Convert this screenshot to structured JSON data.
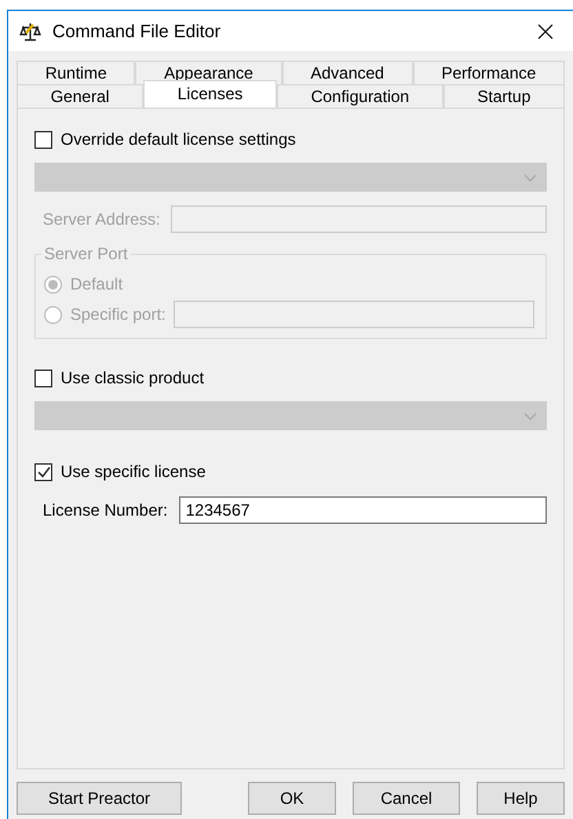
{
  "window": {
    "title": "Command File Editor"
  },
  "tab_rows": [
    [
      {
        "label": "Runtime",
        "selected": false
      },
      {
        "label": "Appearance",
        "selected": false
      },
      {
        "label": "Advanced",
        "selected": false
      },
      {
        "label": "Performance",
        "selected": false
      }
    ],
    [
      {
        "label": "General",
        "selected": false
      },
      {
        "label": "Licenses",
        "selected": true
      },
      {
        "label": "Configuration",
        "selected": false
      },
      {
        "label": "Startup",
        "selected": false
      }
    ]
  ],
  "override": {
    "label": "Override default license settings",
    "checked": false
  },
  "license_dropdown": {
    "disabled": true
  },
  "server_address": {
    "label": "Server Address:",
    "disabled": true
  },
  "server_port": {
    "title": "Server Port",
    "disabled": true,
    "options": [
      {
        "label": "Default",
        "selected": true,
        "has_field": false
      },
      {
        "label": "Specific port:",
        "selected": false,
        "has_field": true
      }
    ]
  },
  "classic_product": {
    "label": "Use classic product",
    "checked": false
  },
  "classic_dropdown": {
    "disabled": true
  },
  "specific_license": {
    "label": "Use specific license",
    "checked": true
  },
  "license_number": {
    "label": "License Number:",
    "value": "1234567",
    "disabled": false
  },
  "footer": {
    "left_buttons": [
      "Start Preactor"
    ],
    "right_buttons": [
      "OK",
      "Cancel",
      "Help"
    ]
  }
}
